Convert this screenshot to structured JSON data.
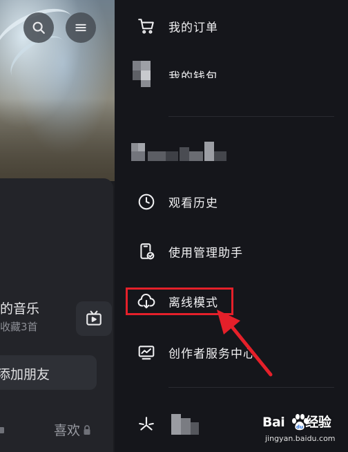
{
  "left_panel": {
    "music_title": "的音乐",
    "music_subtitle": "收藏3首",
    "add_friend_label": "添加朋友",
    "likes_label": "喜欢"
  },
  "drawer": {
    "items": [
      {
        "label": "我的订单",
        "icon": "cart-icon"
      },
      {
        "label": "我的钱包",
        "icon": "wallet-icon"
      },
      {
        "label": "",
        "icon": "pixelated-icon"
      },
      {
        "label": "观看历史",
        "icon": "clock-icon"
      },
      {
        "label": "使用管理助手",
        "icon": "phone-check-icon"
      },
      {
        "label": "离线模式",
        "icon": "cloud-download-icon"
      },
      {
        "label": "创作者服务中心",
        "icon": "chart-monitor-icon"
      },
      {
        "label": "",
        "icon": "spark-icon"
      }
    ]
  },
  "annotation": {
    "highlight_color": "#e5202a"
  },
  "watermark": {
    "brand": "Bai",
    "brand2": "经验",
    "url": "jingyan.baidu.com"
  }
}
